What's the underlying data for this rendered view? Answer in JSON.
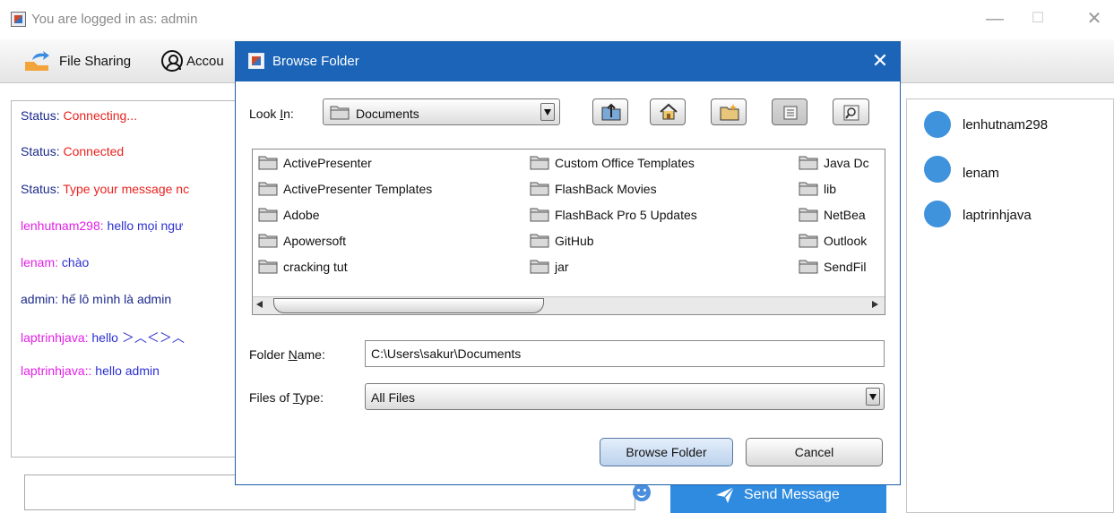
{
  "window": {
    "title": "You are logged in as: admin",
    "minimize": "—",
    "maximize": "☐",
    "close": "✕"
  },
  "menubar": {
    "file_sharing": "File Sharing",
    "account": "Accou"
  },
  "chat": {
    "messages": [
      {
        "sender": "Status:",
        "text": "Connecting..."
      },
      {
        "sender": "Status:",
        "text": "Connected"
      },
      {
        "sender": "Status:",
        "text": "Type your message nc"
      },
      {
        "sender": "lenhutnam298:",
        "text": "hello mọi ngư"
      },
      {
        "sender": "lenam:",
        "text": "chào"
      },
      {
        "sender": "admin:",
        "text": "hế lô mình là admin"
      },
      {
        "sender": "laptrinhjava:",
        "text": "hello ＞︿＜＞︿"
      },
      {
        "sender": "laptrinhjava::",
        "text": "hello admin"
      }
    ],
    "send_label": "Send Message"
  },
  "users": [
    "lenhutnam298",
    "lenam",
    "laptrinhjava"
  ],
  "dialog": {
    "title": "Browse Folder",
    "close": "✕",
    "look_in_label_pre": "Look ",
    "look_in_label_mn": "I",
    "look_in_label_post": "n:",
    "look_in_value": "Documents",
    "files": [
      [
        "ActivePresenter",
        "ActivePresenter Templates",
        "Adobe",
        "Apowersoft",
        "cracking tut"
      ],
      [
        "Custom Office Templates",
        "FlashBack Movies",
        "FlashBack Pro 5 Updates",
        "GitHub",
        "jar"
      ],
      [
        "Java Dc",
        "lib",
        "NetBea",
        "Outlook",
        "SendFil"
      ]
    ],
    "folder_name_label_pre": "Folder ",
    "folder_name_label_mn": "N",
    "folder_name_label_post": "ame:",
    "folder_name_value": "C:\\Users\\sakur\\Documents",
    "files_of_type_label_pre": "Files of ",
    "files_of_type_label_mn": "T",
    "files_of_type_label_post": "ype:",
    "files_of_type_value": "All Files",
    "browse_button": "Browse Folder",
    "cancel_button": "Cancel"
  },
  "colors": {
    "dialog_title_bar": "#1b64b8",
    "send_button": "#2e8be0",
    "status_red": "#e8231f",
    "sender_magenta": "#e21fe6",
    "message_blue": "#2b2fd1",
    "user_dot": "#3f92dc"
  }
}
